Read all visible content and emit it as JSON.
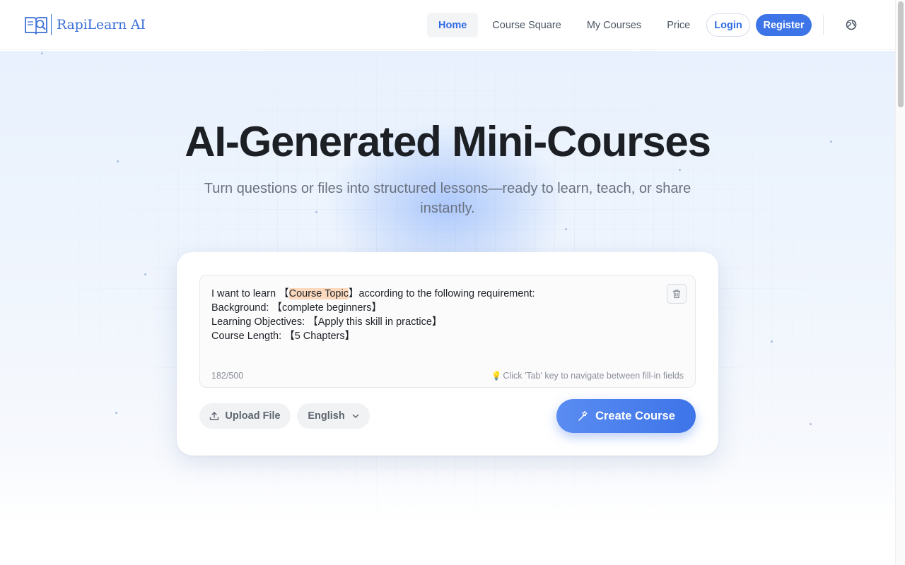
{
  "header": {
    "logo_text": "RapiLearn AI",
    "nav": [
      {
        "label": "Home",
        "active": true
      },
      {
        "label": "Course Square",
        "active": false
      },
      {
        "label": "My Courses",
        "active": false
      },
      {
        "label": "Price",
        "active": false
      }
    ],
    "login_label": "Login",
    "register_label": "Register",
    "language_icon": "globe-icon"
  },
  "hero": {
    "title": "AI-Generated Mini-Courses",
    "subtitle_line1": "Turn questions or files into structured lessons—ready to learn, teach, or share",
    "subtitle_line2": "instantly."
  },
  "prompt": {
    "line1_prefix": "I want to learn ",
    "line1_field": "Course Topic",
    "line1_suffix": "according to the following requirement:",
    "line2_label": "Background: ",
    "line2_field": "complete beginners",
    "line3_label": "Learning Objectives: ",
    "line3_field": "Apply this skill in practice",
    "line4_label": "Course Length: ",
    "line4_field": "5 Chapters",
    "char_count": "182/500",
    "hint": "Click 'Tab' key to navigate between fill-in fields",
    "clear_icon": "trash-icon"
  },
  "actions": {
    "upload_label": "Upload File",
    "language_value": "English",
    "create_label": "Create Course"
  },
  "colors": {
    "accent": "#3d74e8",
    "highlight": "#fcd9bd",
    "title": "#1c1f24"
  }
}
